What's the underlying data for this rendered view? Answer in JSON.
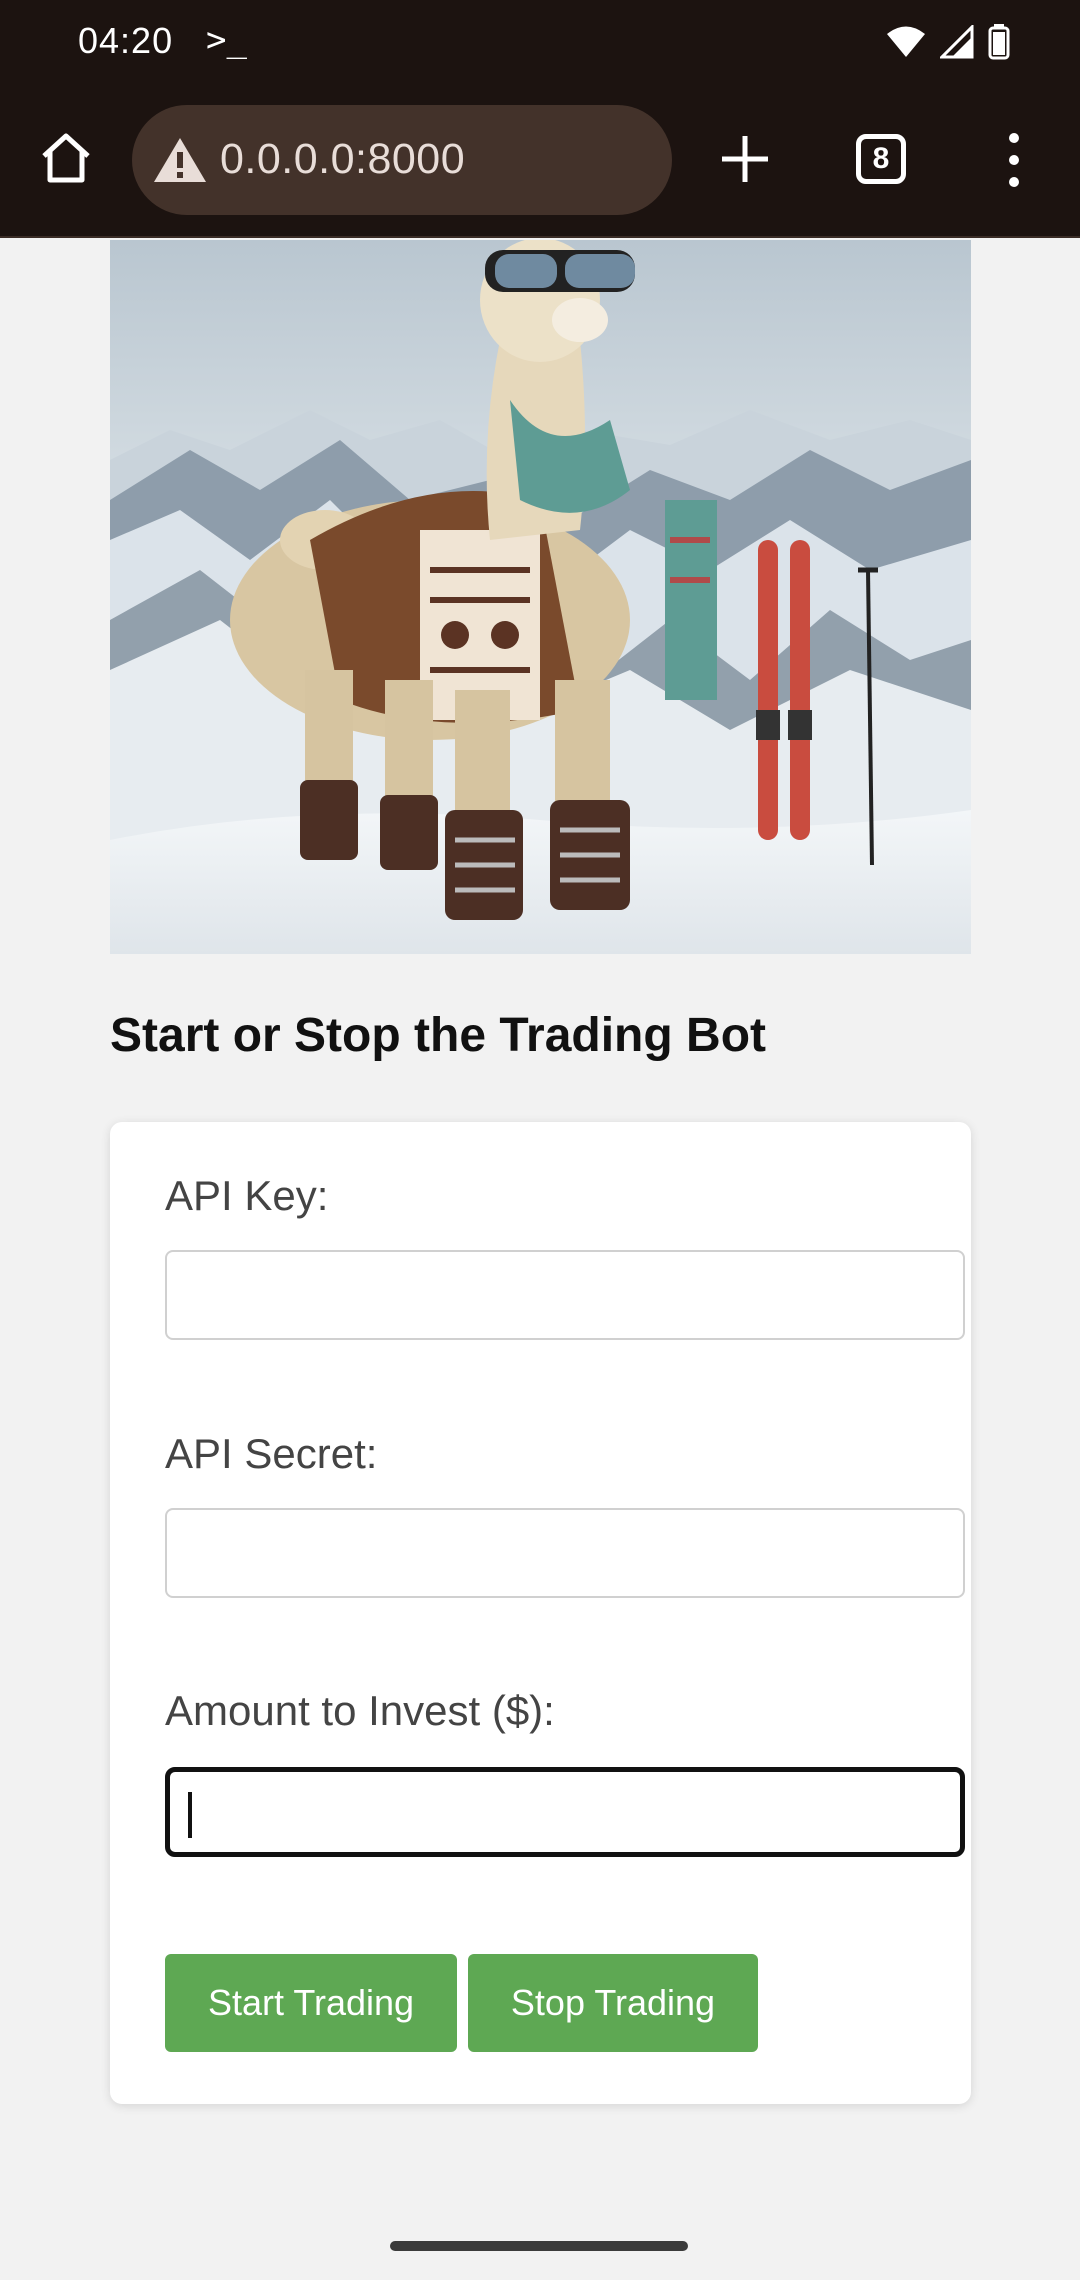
{
  "status_bar": {
    "time": "04:20",
    "terminal_glyph": ">_"
  },
  "browser": {
    "url": "0.0.0.0:8000",
    "tab_count": "8",
    "icons": [
      "home-icon",
      "warning-icon",
      "plus-icon",
      "tabs-icon",
      "more-vert-icon"
    ]
  },
  "hero_image": {
    "alt": "Llama wearing ski goggles, scarf, sweater and boots on a snowy mountain with skis"
  },
  "page": {
    "title": "Start or Stop the Trading Bot"
  },
  "form": {
    "api_key_label": "API Key:",
    "api_key_value": "",
    "api_secret_label": "API Secret:",
    "api_secret_value": "",
    "amount_label": "Amount to Invest ($):",
    "amount_value": "",
    "start_label": "Start Trading",
    "stop_label": "Stop Trading"
  },
  "colors": {
    "chrome_bg": "#1c1310",
    "url_bg": "#43322a",
    "button_green": "#5ea853",
    "page_bg": "#f2f2f2"
  }
}
